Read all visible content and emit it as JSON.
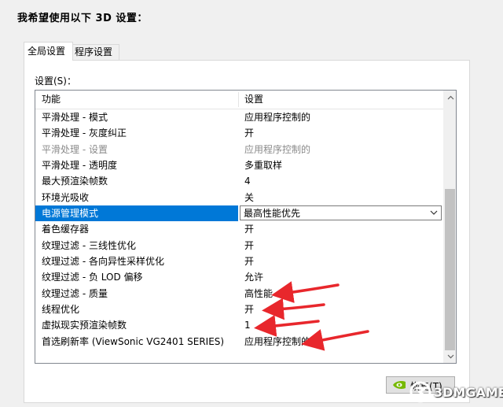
{
  "heading": "我希望使用以下 3D 设置：",
  "tabs": [
    {
      "label": "全局设置",
      "active": true
    },
    {
      "label": "程序设置",
      "active": false
    }
  ],
  "settings_label": "设置(S)：",
  "columns": {
    "feature": "功能",
    "setting": "设置"
  },
  "rows": [
    {
      "feature": "平滑处理 - 模式",
      "value": "应用程序控制的",
      "disabled": false
    },
    {
      "feature": "平滑处理 - 灰度纠正",
      "value": "开",
      "disabled": false
    },
    {
      "feature": "平滑处理 - 设置",
      "value": "应用程序控制的",
      "disabled": true
    },
    {
      "feature": "平滑处理 - 透明度",
      "value": "多重取样",
      "disabled": false
    },
    {
      "feature": "最大预渲染帧数",
      "value": "4",
      "disabled": false
    },
    {
      "feature": "环境光吸收",
      "value": "关",
      "disabled": false
    },
    {
      "feature": "电源管理模式",
      "value": "最高性能优先",
      "disabled": false,
      "selected": true
    },
    {
      "feature": "着色缓存器",
      "value": "开",
      "disabled": false
    },
    {
      "feature": "纹理过滤 - 三线性优化",
      "value": "开",
      "disabled": false
    },
    {
      "feature": "纹理过滤 - 各向异性采样优化",
      "value": "开",
      "disabled": false
    },
    {
      "feature": "纹理过滤 - 负 LOD 偏移",
      "value": "允许",
      "disabled": false
    },
    {
      "feature": "纹理过滤 - 质量",
      "value": "高性能",
      "disabled": false
    },
    {
      "feature": "线程优化",
      "value": "开",
      "disabled": false
    },
    {
      "feature": "虚拟现实预渲染帧数",
      "value": "1",
      "disabled": false
    },
    {
      "feature": "首选刷新率 (ViewSonic VG2401 SERIES)",
      "value": "应用程序控制的",
      "disabled": false
    }
  ],
  "restore_button": {
    "label": "恢复",
    "shortcut": "(T)"
  },
  "watermark": "3DMGAME",
  "colors": {
    "selection": "#0078d7",
    "annotation_arrow": "#e8272c",
    "nvidia_green": "#76b900"
  },
  "icons": {
    "scroll_up": "triangle-up",
    "scroll_down": "triangle-down",
    "dropdown": "chevron-down",
    "nvidia": "nvidia-eye-logo"
  }
}
